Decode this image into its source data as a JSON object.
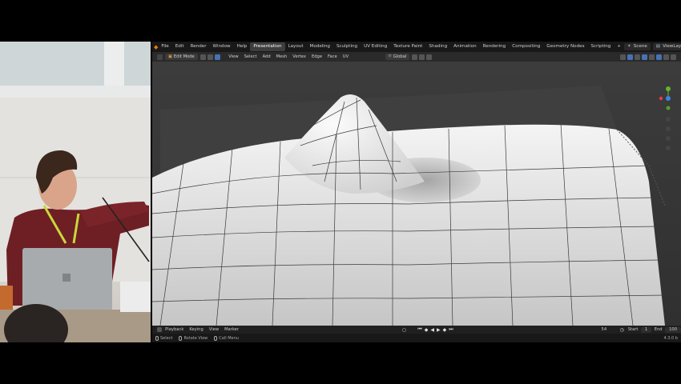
{
  "app": {
    "menus": [
      "File",
      "Edit",
      "Render",
      "Window",
      "Help"
    ],
    "workspaces": [
      "Presentation",
      "Layout",
      "Modeling",
      "Sculpting",
      "UV Editing",
      "Texture Paint",
      "Shading",
      "Animation",
      "Rendering",
      "Compositing",
      "Geometry Nodes",
      "Scripting"
    ],
    "active_workspace": "Presentation",
    "add_workspace": "+",
    "scene_label": "Scene",
    "view_layer_label": "ViewLayer"
  },
  "viewport_header": {
    "mode": "Edit Mode",
    "menus": [
      "View",
      "Select",
      "Add",
      "Mesh",
      "Vertex",
      "Edge",
      "Face",
      "UV"
    ],
    "transform_orientation": "Global"
  },
  "timeline": {
    "menus": [
      "Playback",
      "Keying",
      "View",
      "Marker"
    ],
    "current_frame": "54",
    "start_label": "Start",
    "start_value": "1",
    "end_label": "End",
    "end_value": "100"
  },
  "statusbar": {
    "hints": [
      "Select",
      "Rotate View",
      "Call Menu"
    ],
    "version": "4.3.0 b"
  },
  "colors": {
    "accent_orange": "#e87d0d",
    "selection_blue": "#4772b3",
    "axis_x": "#e5384f",
    "axis_y": "#5fb72b",
    "axis_z": "#3a86e8"
  }
}
